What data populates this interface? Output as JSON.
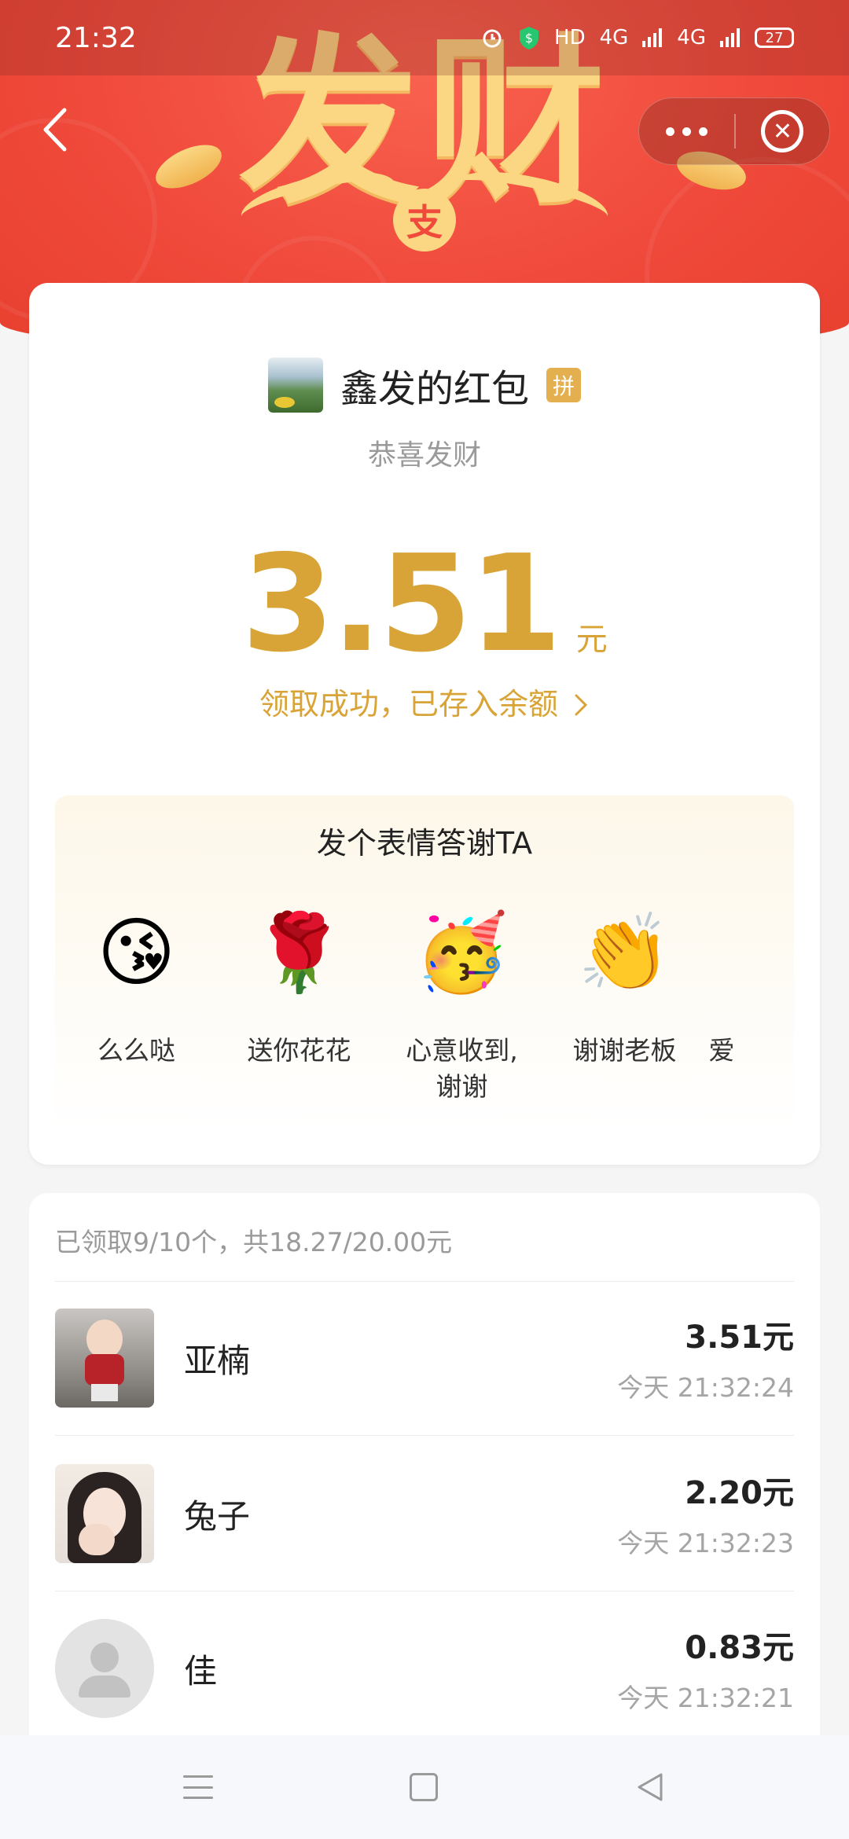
{
  "status_bar": {
    "time": "21:32",
    "hd": "HD",
    "signal_1": "4G",
    "signal_2": "4G",
    "battery": "27"
  },
  "banner": {
    "big_text": "发财",
    "coin_glyph": "支",
    "colors": {
      "red": "#f04a3c",
      "gold": "#fbd783"
    }
  },
  "sender": {
    "name": "鑫发的红包",
    "badge": "拼",
    "greeting": "恭喜发财"
  },
  "amount": {
    "value": "3.51",
    "unit": "元",
    "status": "领取成功，已存入余额",
    "color": "#d9a437"
  },
  "thanks": {
    "title": "发个表情答谢TA",
    "items": [
      {
        "icon": "kiss-face-icon",
        "glyph": "😘",
        "label": "么么哒"
      },
      {
        "icon": "rose-icon",
        "glyph": "🌹",
        "label": "送你花花"
      },
      {
        "icon": "party-face-icon",
        "glyph": "🥳",
        "label": "心意收到,\n谢谢"
      },
      {
        "icon": "clapping-hands-icon",
        "glyph": "👏",
        "label": "谢谢老板"
      },
      {
        "icon": "partial-item-icon",
        "glyph": "",
        "label": "爱"
      }
    ]
  },
  "receivers": {
    "summary": "已领取9/10个，共18.27/20.00元",
    "items": [
      {
        "name": "亚楠",
        "amount": "3.51元",
        "time": "今天 21:32:24"
      },
      {
        "name": "兔子",
        "amount": "2.20元",
        "time": "今天 21:32:23"
      },
      {
        "name": "佳",
        "amount": "0.83元",
        "time": "今天 21:32:21"
      }
    ]
  }
}
